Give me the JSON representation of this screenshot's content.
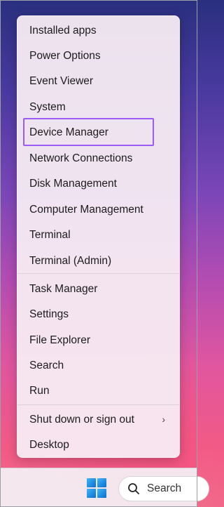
{
  "menu": {
    "items": [
      {
        "label": "Installed apps"
      },
      {
        "label": "Power Options"
      },
      {
        "label": "Event Viewer"
      },
      {
        "label": "System"
      },
      {
        "label": "Device Manager"
      },
      {
        "label": "Network Connections"
      },
      {
        "label": "Disk Management"
      },
      {
        "label": "Computer Management"
      },
      {
        "label": "Terminal"
      },
      {
        "label": "Terminal (Admin)"
      },
      {
        "label": "Task Manager"
      },
      {
        "label": "Settings"
      },
      {
        "label": "File Explorer"
      },
      {
        "label": "Search"
      },
      {
        "label": "Run"
      },
      {
        "label": "Shut down or sign out"
      },
      {
        "label": "Desktop"
      }
    ],
    "highlighted_item": "Device Manager",
    "highlight_color": "#9b5cf5"
  },
  "taskbar": {
    "start_icon": "windows-start-icon",
    "search_label": "Search",
    "search_icon": "search-icon"
  }
}
